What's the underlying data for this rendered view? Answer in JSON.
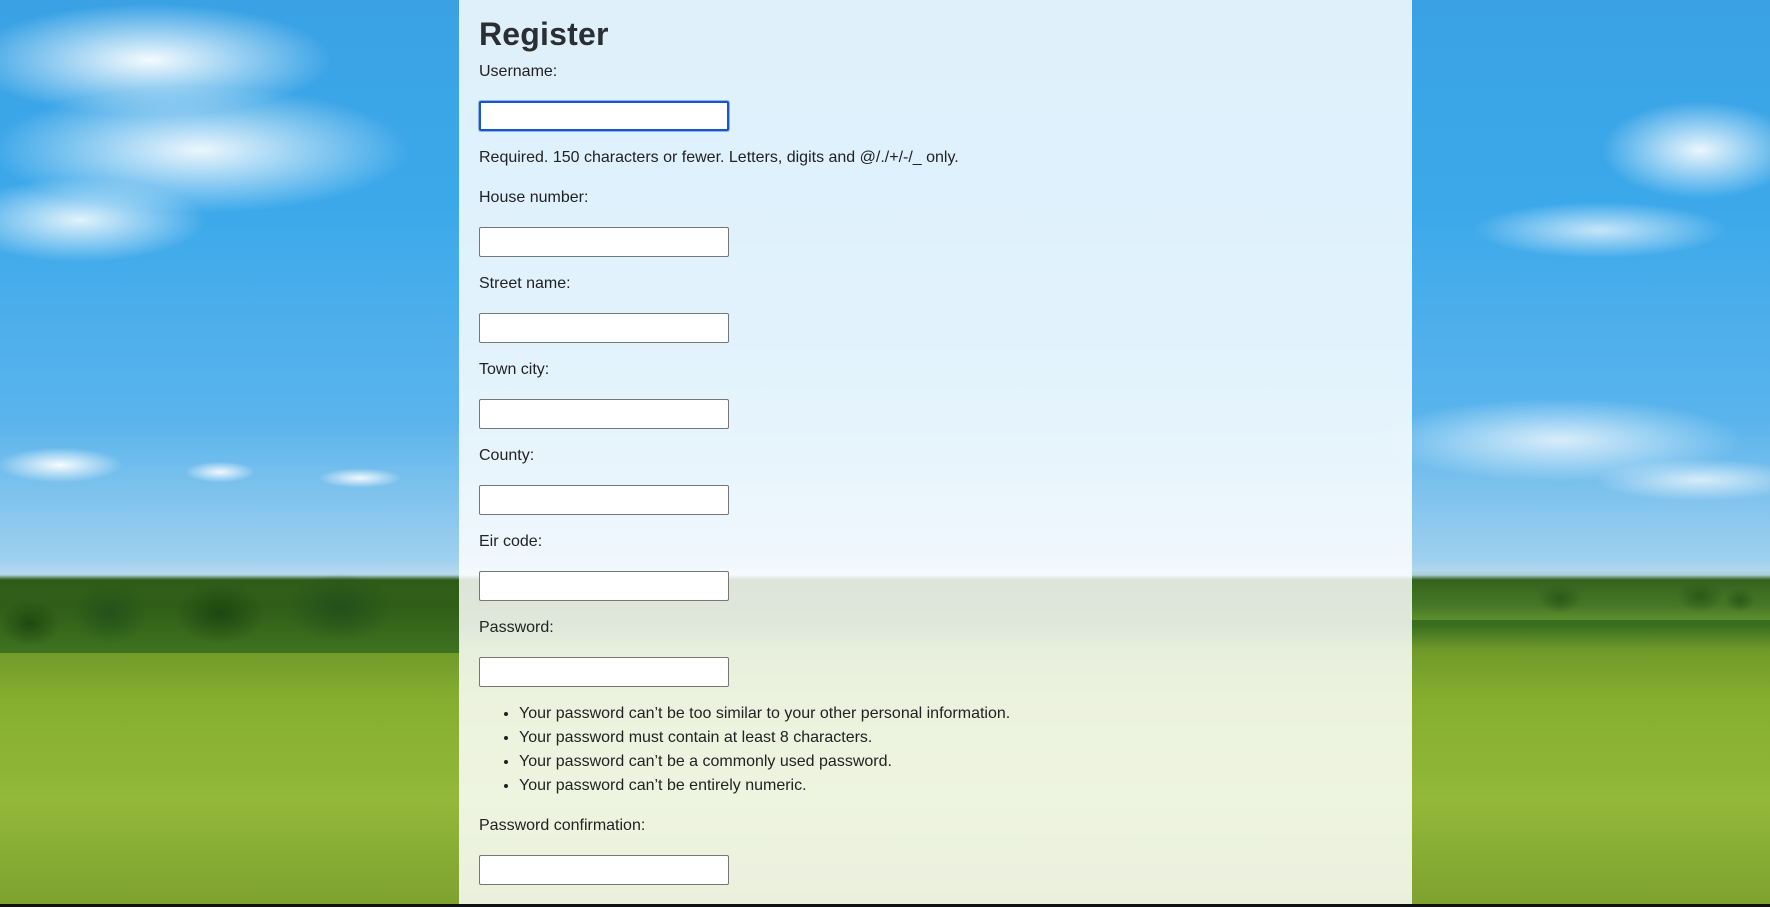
{
  "page_title": "Register",
  "fields": {
    "username": {
      "label": "Username:",
      "value": ""
    },
    "house_number": {
      "label": "House number:",
      "value": ""
    },
    "street_name": {
      "label": "Street name:",
      "value": ""
    },
    "town_city": {
      "label": "Town city:",
      "value": ""
    },
    "county": {
      "label": "County:",
      "value": ""
    },
    "eir_code": {
      "label": "Eir code:",
      "value": ""
    },
    "password": {
      "label": "Password:",
      "value": ""
    },
    "password_confirmation": {
      "label": "Password confirmation:",
      "value": ""
    }
  },
  "username_help": "Required. 150 characters or fewer. Letters, digits and @/./+/-/_ only.",
  "password_rules": [
    "Your password can’t be too similar to your other personal information.",
    "Your password must contain at least 8 characters.",
    "Your password can’t be a commonly used password.",
    "Your password can’t be entirely numeric."
  ],
  "colors": {
    "focus_ring": "#1a56c9",
    "panel_background": "rgba(255,255,255,0.84)",
    "title_text": "#2b2f33"
  }
}
